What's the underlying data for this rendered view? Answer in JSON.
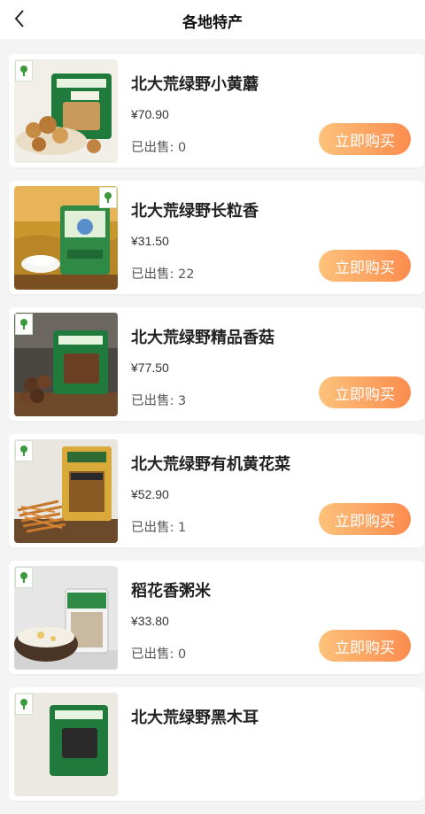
{
  "header": {
    "title": "各地特产",
    "back_icon": "chevron-left-icon"
  },
  "buy_label": "立即购买",
  "colors": {
    "button_gradient_start": "#fdc27b",
    "button_gradient_end": "#fb8c4e",
    "background": "#f4f4f4"
  },
  "products": [
    {
      "name": "北大荒绿野小黄蘑",
      "price": "¥70.90",
      "sold": "已出售: 0",
      "image": "mushroom-package-image"
    },
    {
      "name": "北大荒绿野长粒香",
      "price": "¥31.50",
      "sold": "已出售: 22",
      "image": "rice-bag-image"
    },
    {
      "name": "北大荒绿野精品香菇",
      "price": "¥77.50",
      "sold": "已出售: 3",
      "image": "shiitake-package-image"
    },
    {
      "name": "北大荒绿野有机黄花菜",
      "price": "¥52.90",
      "sold": "已出售: 1",
      "image": "daylily-package-image"
    },
    {
      "name": "稻花香粥米",
      "price": "¥33.80",
      "sold": "已出售: 0",
      "image": "porridge-rice-image"
    },
    {
      "name": "北大荒绿野黑木耳",
      "price": "",
      "sold": "",
      "image": "black-fungus-package-image"
    }
  ]
}
